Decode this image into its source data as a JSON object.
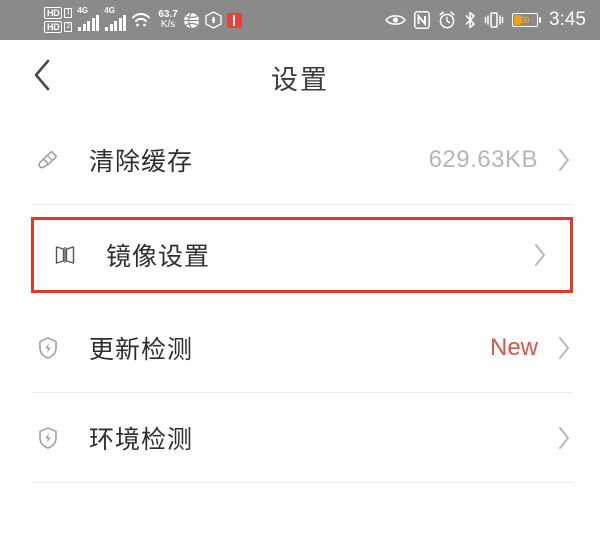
{
  "status_bar": {
    "background": "#8a8a8a",
    "hd_badges": [
      "HD",
      "HD"
    ],
    "network_labels": [
      "4G",
      "4G"
    ],
    "wifi_icon": "wifi-icon",
    "network_speed_value": "63.7",
    "network_speed_unit": "K/s",
    "tray_icons": [
      "globe-icon",
      "hexagon-shield-icon",
      "red-app-icon"
    ],
    "right_icons": [
      "eye-icon",
      "nfc-icon",
      "alarm-clock-icon",
      "bluetooth-icon",
      "vibrate-icon"
    ],
    "battery_percent": "20",
    "battery_color": "#f0a020",
    "time": "3:45"
  },
  "title_bar": {
    "back_icon": "chevron-left-icon",
    "title": "设置"
  },
  "list": {
    "highlight_color": "#e03b26",
    "items": [
      {
        "id": "clear-cache",
        "icon": "broom-icon",
        "label": "清除缓存",
        "value": "629.63KB",
        "badge": "",
        "highlighted": false
      },
      {
        "id": "mirror-settings",
        "icon": "mirror-icon",
        "label": "镜像设置",
        "value": "",
        "badge": "",
        "highlighted": true
      },
      {
        "id": "update-check",
        "icon": "shield-bolt-icon",
        "label": "更新检测",
        "value": "",
        "badge": "New",
        "highlighted": false
      },
      {
        "id": "environment-check",
        "icon": "shield-bolt-icon",
        "label": "环境检测",
        "value": "",
        "badge": "",
        "highlighted": false
      }
    ]
  }
}
